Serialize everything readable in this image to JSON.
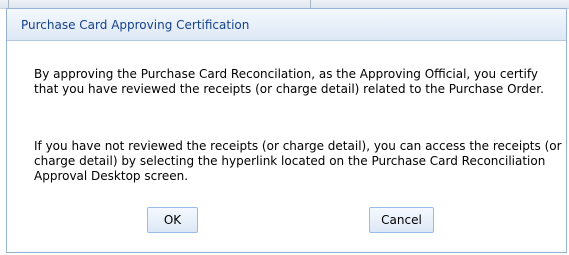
{
  "dialog": {
    "title": "Purchase Card Approving Certification",
    "paragraphs": [
      "By approving the Purchase Card Reconcilation, as the Approving Official, you certify that you have reviewed the receipts (or charge detail) related to the Purchase Order.",
      "If you have not reviewed the receipts (or charge detail), you can access the receipts (or charge detail) by selecting the hyperlink located on the Purchase Card Reconciliation Approval Desktop screen."
    ],
    "buttons": {
      "ok_label": "OK",
      "cancel_label": "Cancel"
    }
  },
  "colors": {
    "title_text": "#15428b",
    "dialog_border": "#98b2d4",
    "button_border": "#99bbe8"
  }
}
